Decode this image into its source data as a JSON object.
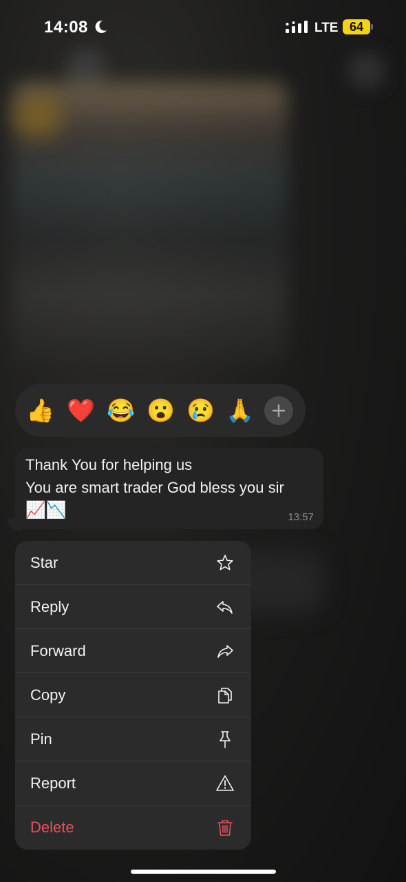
{
  "status_bar": {
    "time": "14:08",
    "network": "LTE",
    "battery": "64",
    "battery_color": "#f5d312"
  },
  "reactions": [
    {
      "emoji": "👍",
      "name": "thumbs-up"
    },
    {
      "emoji": "❤️",
      "name": "heart"
    },
    {
      "emoji": "😂",
      "name": "laughing"
    },
    {
      "emoji": "😮",
      "name": "surprised"
    },
    {
      "emoji": "😢",
      "name": "crying"
    },
    {
      "emoji": "🙏",
      "name": "praying"
    }
  ],
  "message": {
    "line1": "Thank You for helping us",
    "line2": "You are smart trader God bless you sir",
    "line3": "📈📉",
    "time": "13:57"
  },
  "menu": [
    {
      "label": "Star",
      "icon": "star-icon"
    },
    {
      "label": "Reply",
      "icon": "reply-icon"
    },
    {
      "label": "Forward",
      "icon": "forward-icon"
    },
    {
      "label": "Copy",
      "icon": "copy-icon"
    },
    {
      "label": "Pin",
      "icon": "pin-icon"
    },
    {
      "label": "Report",
      "icon": "warning-icon"
    },
    {
      "label": "Delete",
      "icon": "trash-icon"
    }
  ],
  "colors": {
    "delete": "#e8505b",
    "menu_bg": "#2b2b2b",
    "bubble_bg": "#242424"
  }
}
